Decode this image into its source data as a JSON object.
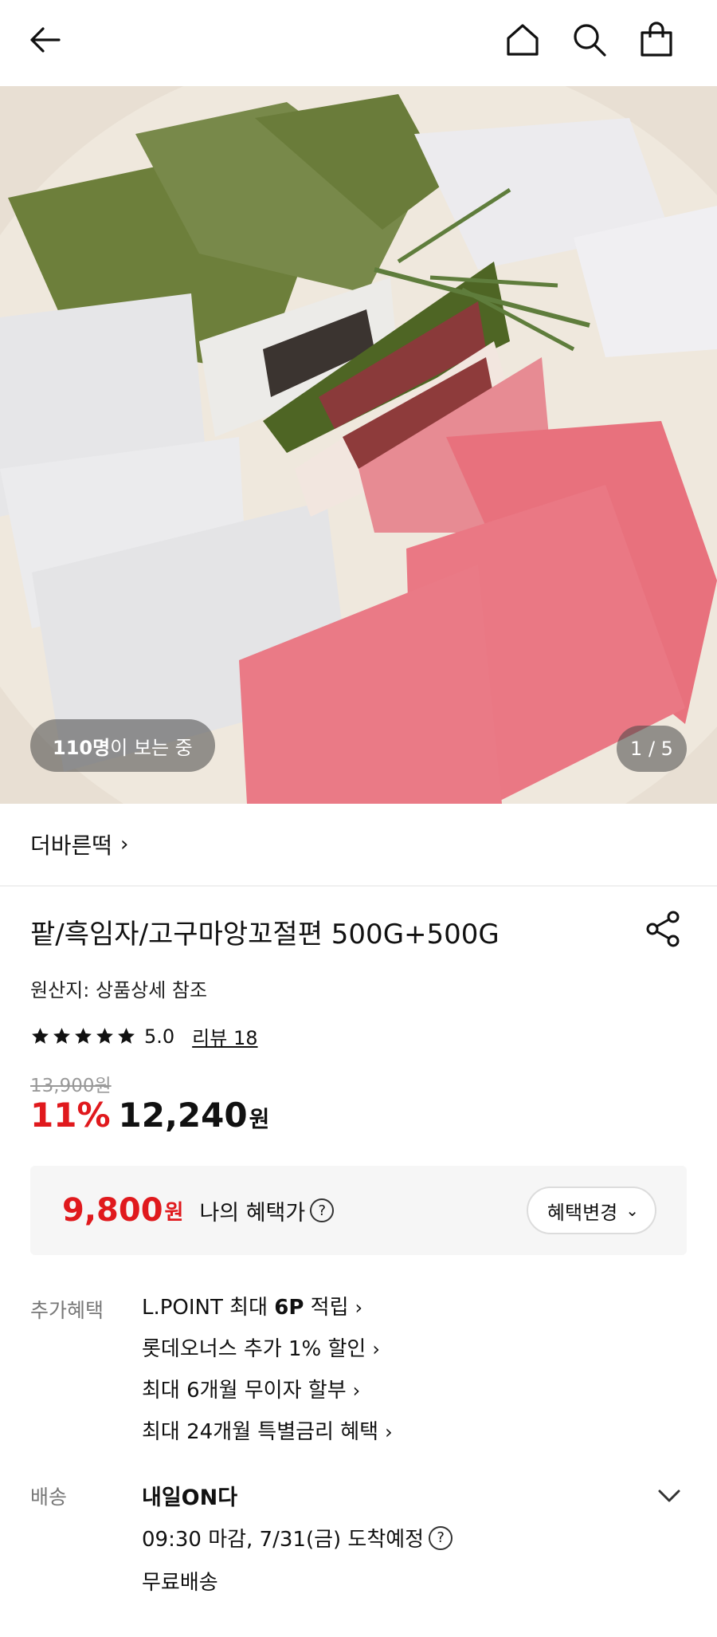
{
  "header": {
    "icons": [
      "back-arrow-icon",
      "home-icon",
      "search-icon",
      "shopping-bag-icon"
    ]
  },
  "gallery": {
    "viewers_count": "110명",
    "viewers_suffix": "이 보는 중",
    "counter": "1 / 5"
  },
  "brand": {
    "name": "더바른떡",
    "chevron": "›"
  },
  "product": {
    "title": "팥/흑임자/고구마앙꼬절편 500G+500G",
    "origin": "원산지: 상품상세 참조",
    "rating": "5.0",
    "rating_stars": 5,
    "review_link": "리뷰 18",
    "original_price": "13,900원",
    "discount": "11%",
    "sale_price": "12,240",
    "currency": "원"
  },
  "benefit": {
    "price": "9,800",
    "currency": "원",
    "label": "나의 혜택가",
    "help": "?",
    "change_button": "혜택변경",
    "change_chevron": "⌄"
  },
  "extra_benefits": {
    "label": "추가혜택",
    "items": [
      {
        "pre": "L.POINT 최대 ",
        "bold": "6P",
        "post": " 적립"
      },
      {
        "pre": "롯데오너스 추가 1% 할인",
        "bold": "",
        "post": ""
      },
      {
        "pre": "최대 6개월 무이자 할부",
        "bold": "",
        "post": ""
      },
      {
        "pre": "최대 24개월 특별금리 혜택",
        "bold": "",
        "post": ""
      }
    ],
    "chevron": "›"
  },
  "shipping": {
    "label": "배송",
    "name": "내일ON다",
    "time": "09:30 마감, 7/31(금) 도착예정",
    "help": "?",
    "fee": "무료배송"
  },
  "colors": {
    "accent_red": "#e0191d",
    "muted": "#777777",
    "benefit_bg": "#f6f6f6"
  }
}
